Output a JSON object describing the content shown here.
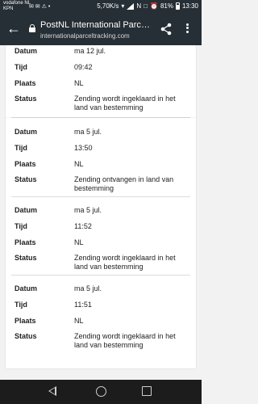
{
  "status_bar": {
    "carrier_line1": "vodafone NL",
    "carrier_line2": "KPN",
    "left_icons": "✉ ✉ ⚠ •",
    "net_speed": "5,70K/s",
    "battery_text": "81%",
    "time": "13:30"
  },
  "app_bar": {
    "title": "PostNL International Parcel ...",
    "url": "internationalparceltracking.com"
  },
  "labels": {
    "date": "Datum",
    "time": "Tijd",
    "place": "Plaats",
    "status": "Status"
  },
  "events": [
    {
      "date": "ma 12 jul.",
      "time": "09:42",
      "place": "NL",
      "status": "Zending wordt ingeklaard in het land van bestemming"
    },
    {
      "date": "ma 5 jul.",
      "time": "13:50",
      "place": "NL",
      "status": "Zending ontvangen in land van bestemming"
    },
    {
      "date": "ma 5 jul.",
      "time": "11:52",
      "place": "NL",
      "status": "Zending wordt ingeklaard in het land van bestemming"
    },
    {
      "date": "ma 5 jul.",
      "time": "11:51",
      "place": "NL",
      "status": "Zending wordt ingeklaard in het land van bestemming"
    }
  ],
  "colors": {
    "toolbar": "#262f36",
    "navbar": "#1c1c1c",
    "background": "#f2f2f2"
  }
}
